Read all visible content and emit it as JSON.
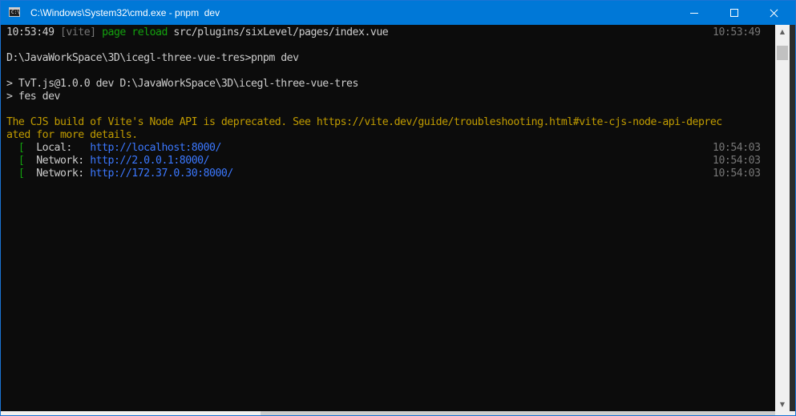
{
  "window": {
    "title": "C:\\Windows\\System32\\cmd.exe - pnpm  dev",
    "icon": "cmd-icon",
    "icon_text": "C:\\"
  },
  "console": {
    "line1": {
      "time": "10:53:49",
      "tag": "[vite]",
      "action": "page reload",
      "path": "src/plugins/sixLevel/pages/index.vue",
      "timestamp": "10:53:49"
    },
    "line2": "D:\\JavaWorkSpace\\3D\\icegl-three-vue-tres>pnpm dev",
    "line3": "> TvT.js@1.0.0 dev D:\\JavaWorkSpace\\3D\\icegl-three-vue-tres",
    "line4": "> fes dev",
    "warning1": "The CJS build of Vite's Node API is deprecated. See https://vite.dev/guide/troubleshooting.html#vite-cjs-node-api-deprec",
    "warning2": "ated for more details.",
    "servers": [
      {
        "marker": "[",
        "label": "Local:  ",
        "url": "http://localhost:8000/",
        "timestamp": "10:54:03"
      },
      {
        "marker": "[",
        "label": "Network:",
        "url": "http://2.0.0.1:8000/",
        "timestamp": "10:54:03"
      },
      {
        "marker": "[",
        "label": "Network:",
        "url": "http://172.37.0.30:8000/",
        "timestamp": "10:54:03"
      }
    ]
  },
  "colors": {
    "titlebar": "#0078d7",
    "background": "#0c0c0c",
    "text": "#cccccc",
    "green": "#13a10e",
    "yellow": "#c19c00",
    "blue": "#3b78ff",
    "gray": "#767676"
  }
}
